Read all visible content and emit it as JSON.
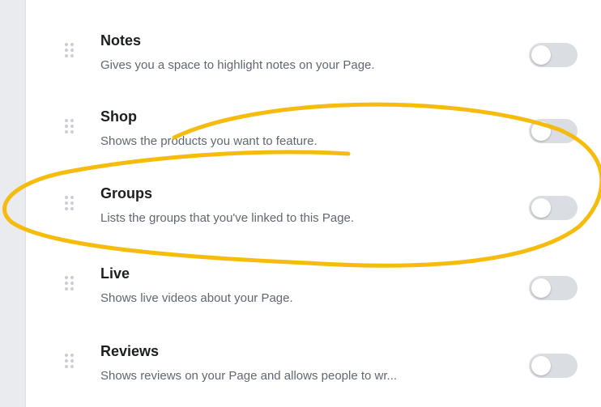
{
  "sections": [
    {
      "title": "Notes",
      "description": "Gives you a space to highlight notes on your Page.",
      "enabled": false
    },
    {
      "title": "Shop",
      "description": "Shows the products you want to feature.",
      "enabled": false
    },
    {
      "title": "Groups",
      "description": "Lists the groups that you've linked to this Page.",
      "enabled": false
    },
    {
      "title": "Live",
      "description": "Shows live videos about your Page.",
      "enabled": false
    },
    {
      "title": "Reviews",
      "description": "Shows reviews on your Page and allows people to wr...",
      "enabled": false
    }
  ],
  "annotation": {
    "shape": "ellipse",
    "color": "#f5b800",
    "encircles": "Groups"
  },
  "colors": {
    "toggle_off": "#dadde1",
    "title": "#1c1e21",
    "description": "#606770"
  }
}
